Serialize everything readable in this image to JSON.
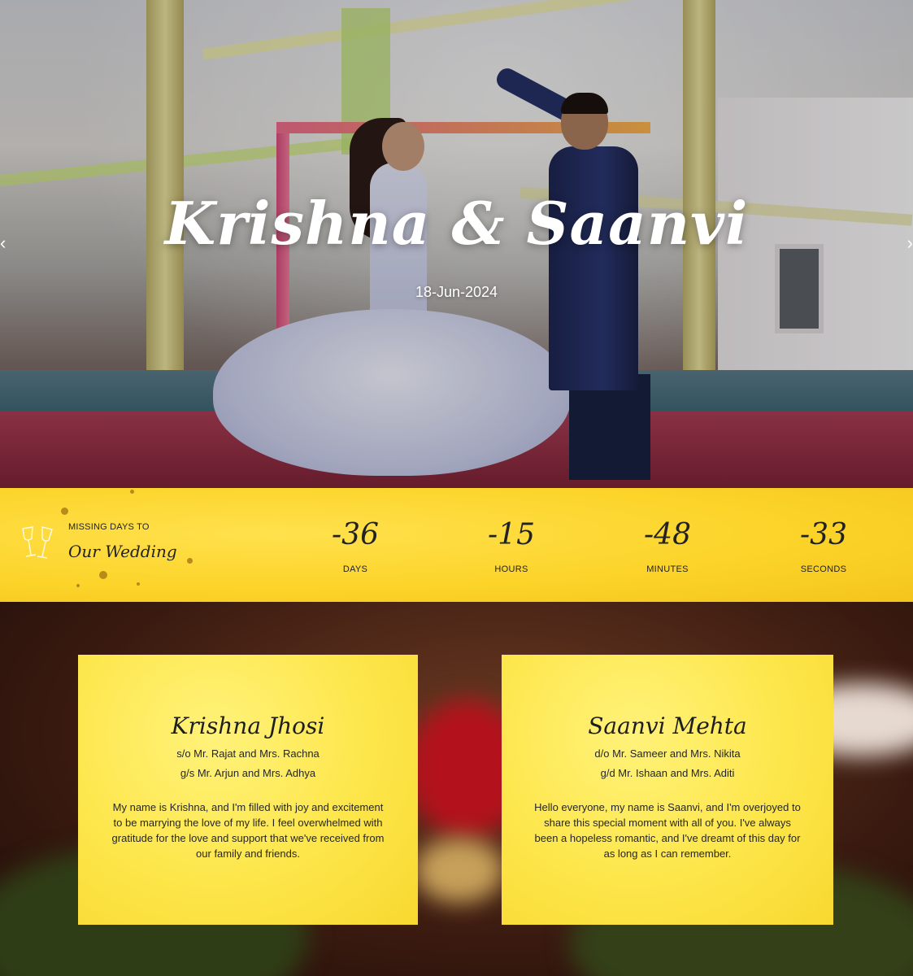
{
  "hero": {
    "title": "Krishna & Saanvi",
    "date": "18-Jun-2024",
    "prev_icon": "‹",
    "next_icon": "›"
  },
  "countdown": {
    "caption": "MISSING DAYS TO",
    "script": "Our Wedding",
    "icon": "champagne-glasses-icon",
    "units": [
      {
        "value": "-36",
        "label": "DAYS"
      },
      {
        "value": "-15",
        "label": "HOURS"
      },
      {
        "value": "-48",
        "label": "MINUTES"
      },
      {
        "value": "-33",
        "label": "SECONDS"
      }
    ]
  },
  "profiles": {
    "groom": {
      "name": "Krishna Jhosi",
      "parents": "s/o Mr. Rajat and Mrs. Rachna",
      "grandparents": "g/s Mr. Arjun and Mrs. Adhya",
      "bio": "My name is Krishna, and I'm filled with joy and excitement to be marrying the love of my life. I feel overwhelmed with gratitude for the love and support that we've received from our family and friends."
    },
    "bride": {
      "name": "Saanvi Mehta",
      "parents": "d/o Mr. Sameer and Mrs. Nikita",
      "grandparents": "g/d Mr. Ishaan and Mrs. Aditi",
      "bio": "Hello everyone, my name is Saanvi, and I'm overjoyed to share this special moment with all of you. I've always been a hopeless romantic, and I've dreamt of this day for as long as I can remember."
    }
  },
  "colors": {
    "accent_yellow": "#fcd42a",
    "card_yellow": "#fde64a",
    "text_dark": "#222222"
  }
}
